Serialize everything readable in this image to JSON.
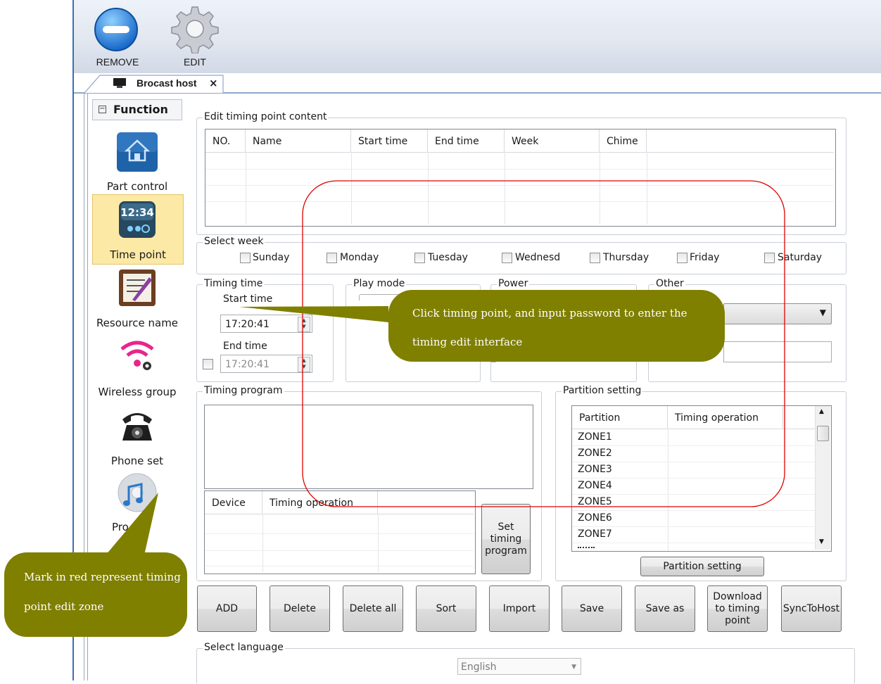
{
  "toolbar": {
    "remove_label": "REMOVE",
    "edit_label": "EDIT"
  },
  "tab": {
    "label": "Brocast host",
    "close": "×"
  },
  "function_panel": {
    "header": "Function",
    "items": [
      {
        "label": "Part control",
        "icon": "house-icon"
      },
      {
        "label": "Time point",
        "icon": "clock-icon"
      },
      {
        "label": "Resource name",
        "icon": "notepad-icon"
      },
      {
        "label": "Wireless group",
        "icon": "wireless-icon"
      },
      {
        "label": "Phone set",
        "icon": "phone-icon"
      },
      {
        "label": "Pro",
        "icon": "music-icon"
      }
    ]
  },
  "timing_point": {
    "caption": "Edit timing point content",
    "columns": [
      "NO.",
      "Name",
      "Start time",
      "End time",
      "Week",
      "Chime"
    ]
  },
  "select_week": {
    "caption": "Select week",
    "days": [
      "Sunday",
      "Monday",
      "Tuesday",
      "Wednesd",
      "Thursday",
      "Friday",
      "Saturday"
    ]
  },
  "timing_time": {
    "caption": "Timing time",
    "start_label": "Start time",
    "start_value": "17:20:41",
    "end_label": "End time",
    "end_value": "17:20:41"
  },
  "play_mode": {
    "caption": "Play mode"
  },
  "power": {
    "caption": "Power"
  },
  "other": {
    "caption": "Other"
  },
  "timing_program": {
    "caption": "Timing program",
    "device_columns": [
      "Device",
      "Timing operation"
    ],
    "set_button": "Set timing program"
  },
  "partition_setting": {
    "caption": "Partition setting",
    "columns": [
      "Partition",
      "Timing operation"
    ],
    "zones": [
      "ZONE1",
      "ZONE2",
      "ZONE3",
      "ZONE4",
      "ZONE5",
      "ZONE6",
      "ZONE7"
    ],
    "button": "Partition setting"
  },
  "actions": {
    "add": "ADD",
    "delete": "Delete",
    "delete_all": "Delete all",
    "sort": "Sort",
    "import": "Import",
    "save": "Save",
    "save_as": "Save as",
    "download": "Download to timing point",
    "sync": "SyncToHost"
  },
  "language": {
    "caption": "Select language",
    "value": "English"
  },
  "annotations": {
    "top_callout": "Click timing point, and input password to enter the timing edit interface",
    "bottom_callout": "Mark in red represent timing point edit zone"
  },
  "colors": {
    "callout": "#7f7f00",
    "highlight": "#e00000",
    "selected_item": "#fde9a6"
  }
}
